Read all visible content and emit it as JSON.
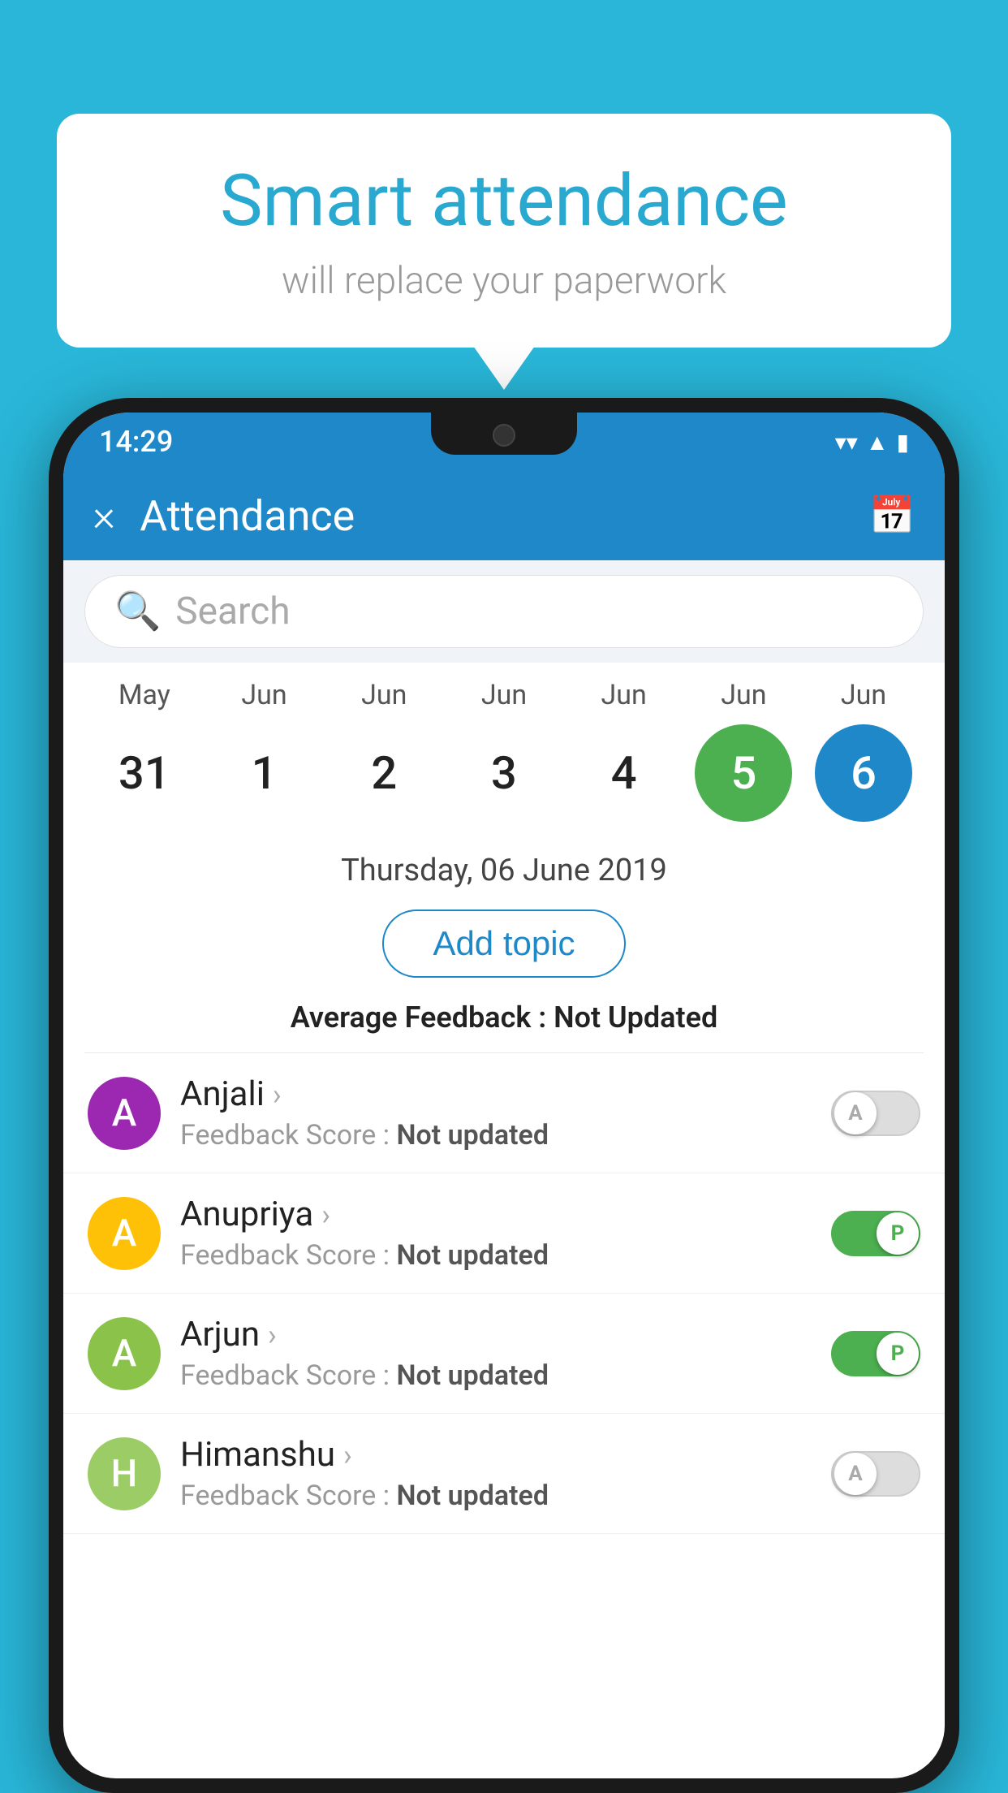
{
  "background_color": "#29B6D8",
  "speech_bubble": {
    "heading": "Smart attendance",
    "subtext": "will replace your paperwork"
  },
  "status_bar": {
    "time": "14:29",
    "icons": [
      "wifi",
      "signal",
      "battery"
    ]
  },
  "app_bar": {
    "close_label": "×",
    "title": "Attendance",
    "calendar_icon": "📅"
  },
  "search": {
    "placeholder": "Search"
  },
  "calendar": {
    "months": [
      "May",
      "Jun",
      "Jun",
      "Jun",
      "Jun",
      "Jun",
      "Jun"
    ],
    "dates": [
      "31",
      "1",
      "2",
      "3",
      "4",
      "5",
      "6"
    ],
    "today_index": 5,
    "selected_index": 6
  },
  "selected_date_label": "Thursday, 06 June 2019",
  "add_topic_label": "Add topic",
  "average_feedback": {
    "label": "Average Feedback : ",
    "value": "Not Updated"
  },
  "students": [
    {
      "name": "Anjali",
      "avatar_letter": "A",
      "avatar_color": "purple",
      "feedback_label": "Feedback Score : ",
      "feedback_value": "Not updated",
      "toggle_state": "off",
      "toggle_letter": "A"
    },
    {
      "name": "Anupriya",
      "avatar_letter": "A",
      "avatar_color": "yellow",
      "feedback_label": "Feedback Score : ",
      "feedback_value": "Not updated",
      "toggle_state": "on",
      "toggle_letter": "P"
    },
    {
      "name": "Arjun",
      "avatar_letter": "A",
      "avatar_color": "green-light",
      "feedback_label": "Feedback Score : ",
      "feedback_value": "Not updated",
      "toggle_state": "on",
      "toggle_letter": "P"
    },
    {
      "name": "Himanshu",
      "avatar_letter": "H",
      "avatar_color": "olive",
      "feedback_label": "Feedback Score : ",
      "feedback_value": "Not updated",
      "toggle_state": "off",
      "toggle_letter": "A"
    }
  ]
}
